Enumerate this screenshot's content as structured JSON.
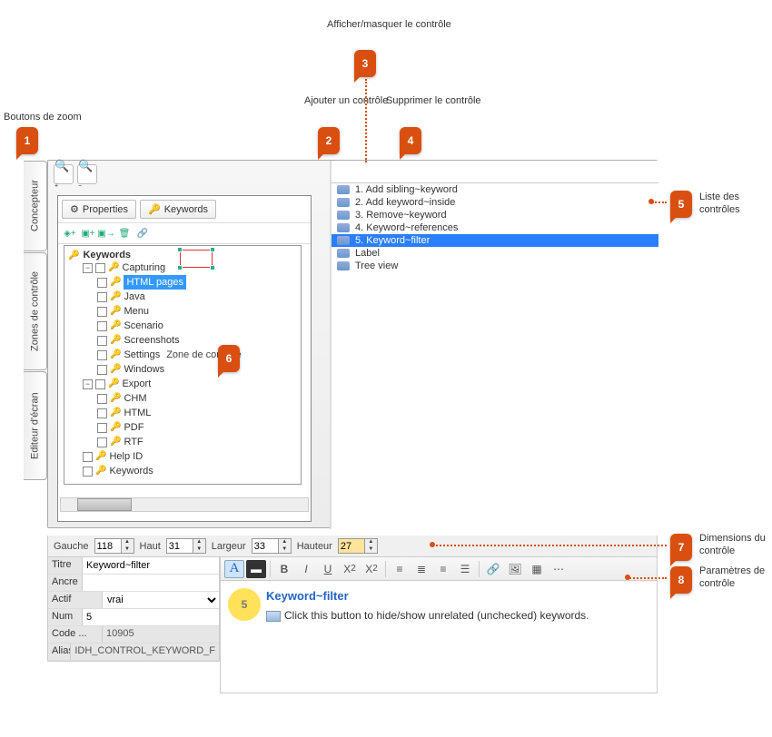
{
  "annotations": {
    "a1": {
      "num": "1",
      "label": "Boutons de zoom"
    },
    "a2": {
      "num": "2",
      "label": "Ajouter un\ncontrôle"
    },
    "a3": {
      "num": "3",
      "label": "Afficher/masquer\nle contrôle"
    },
    "a4": {
      "num": "4",
      "label": "Supprimer\nle contrôle"
    },
    "a5": {
      "num": "5",
      "label": "Liste\ndes contrôles"
    },
    "a6": {
      "num": "6",
      "label": "Zone de contrôle"
    },
    "a7": {
      "num": "7",
      "label": "Dimensions\ndu contrôle"
    },
    "a8": {
      "num": "8",
      "label": "Paramètres\nde contrôle"
    }
  },
  "side_tabs": {
    "t1": "Concepteur",
    "t2": "Zones de contrôle",
    "t3": "Editeur d'écran"
  },
  "design_panel": {
    "btn_properties": "Properties",
    "btn_keywords": "Keywords"
  },
  "tree": {
    "root": "Keywords",
    "group1": "Capturing",
    "g1_items": [
      "HTML pages",
      "Java",
      "Menu",
      "Scenario",
      "Screenshots",
      "Settings",
      "Windows"
    ],
    "group2": "Export",
    "g2_items": [
      "CHM",
      "HTML",
      "PDF",
      "RTF"
    ],
    "extra": [
      "Help ID",
      "Keywords"
    ]
  },
  "ctrl_list": {
    "items": [
      "1. Add sibling~keyword",
      "2. Add keyword~inside",
      "3. Remove~keyword",
      "4. Keyword~references",
      "5. Keyword~filter",
      "Label",
      "Tree view"
    ],
    "selected_index": 4
  },
  "dims": {
    "l_gauche": "Gauche",
    "v_gauche": "118",
    "l_haut": "Haut",
    "v_haut": "31",
    "l_larg": "Largeur",
    "v_larg": "33",
    "l_haute": "Hauteur",
    "v_haute": "27"
  },
  "props": {
    "l_titre": "Titre",
    "v_titre": "Keyword~filter",
    "l_ancre": "Ancre",
    "v_ancre": "",
    "l_actif": "Actif",
    "v_actif": "vrai",
    "l_num": "Num",
    "v_num": "5",
    "l_code": "Code ...",
    "v_code": "10905",
    "l_alias": "Alias",
    "v_alias": "IDH_CONTROL_KEYWORD_F"
  },
  "rte": {
    "heading": "Keyword~filter",
    "star_num": "5",
    "body": "Click this button to hide/show unrelated (unchecked) keywords."
  }
}
